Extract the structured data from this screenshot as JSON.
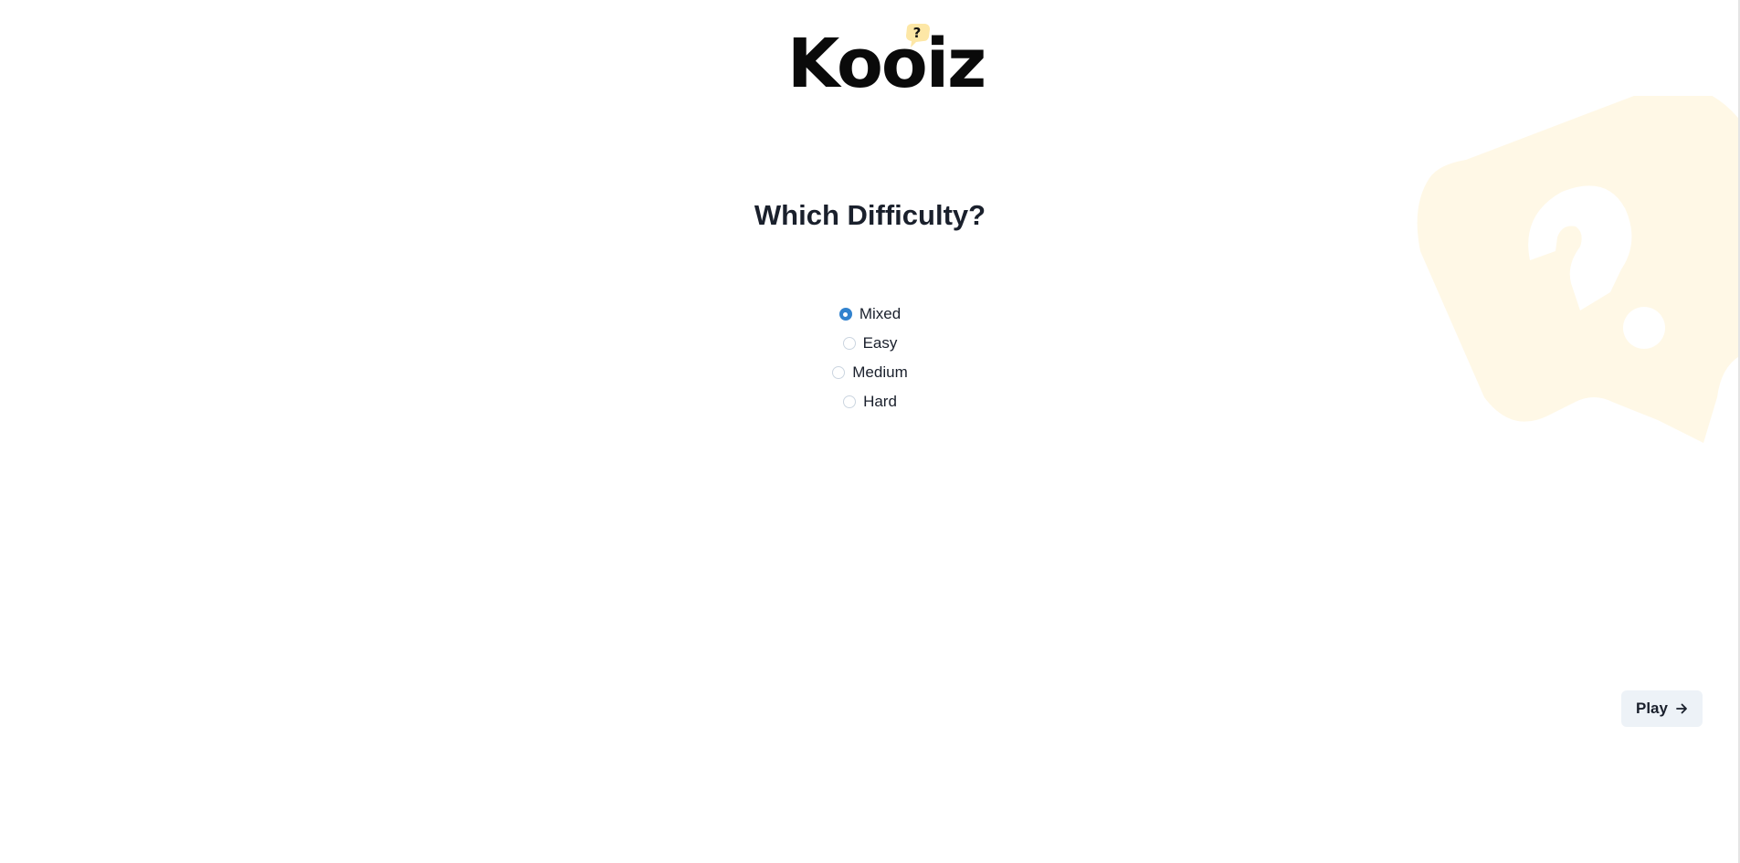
{
  "brand": {
    "name": "Kooiz",
    "bubble_glyph": "?",
    "bubble_color": "#fde7a6"
  },
  "question": {
    "title": "Which Difficulty?"
  },
  "difficulty": {
    "selected": "Mixed",
    "options": [
      {
        "label": "Mixed",
        "checked": true
      },
      {
        "label": "Easy",
        "checked": false
      },
      {
        "label": "Medium",
        "checked": false
      },
      {
        "label": "Hard",
        "checked": false
      }
    ]
  },
  "actions": {
    "play_label": "Play",
    "play_icon": "arrow-right-icon"
  },
  "colors": {
    "accent": "#3182ce",
    "background_mark": "#fff8e6",
    "button_bg": "#edf2f7",
    "text": "#1a202c"
  }
}
